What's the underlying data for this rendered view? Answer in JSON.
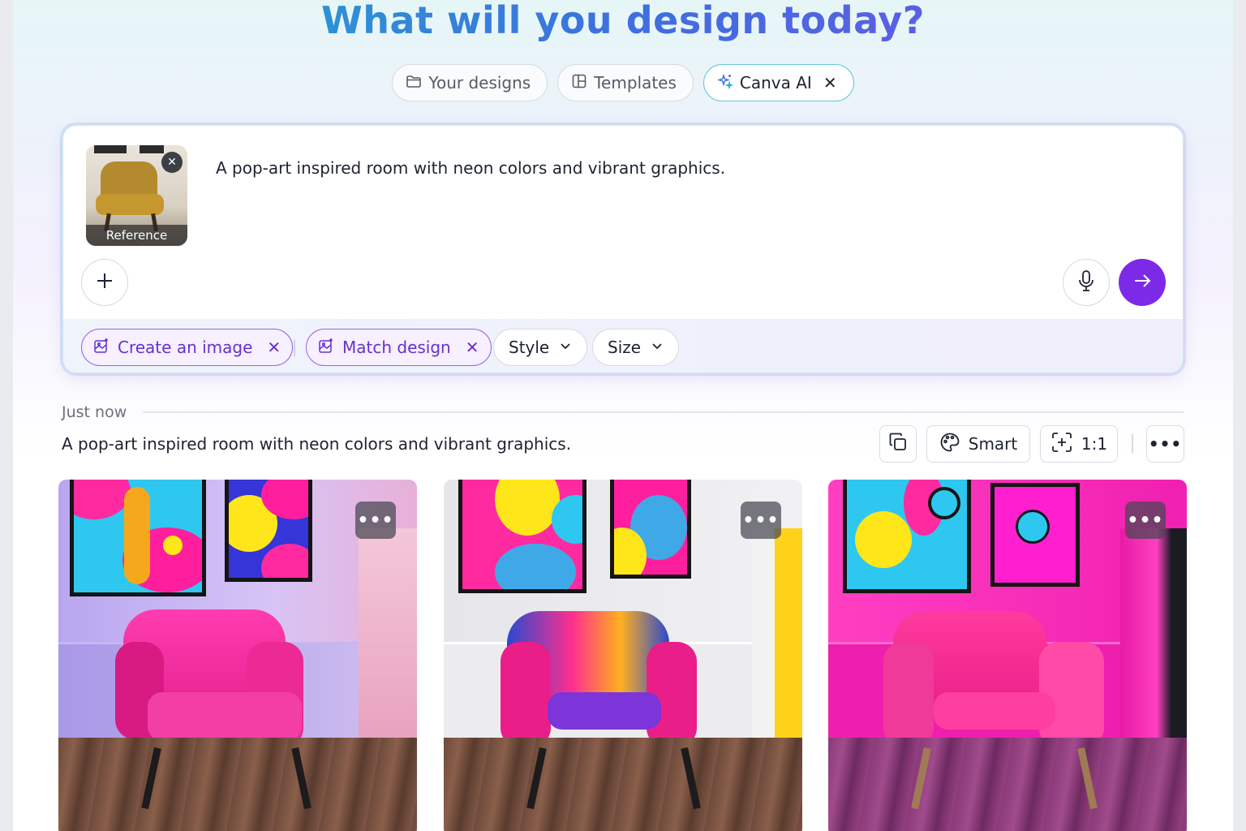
{
  "header": {
    "title": "What will you design today?"
  },
  "tabs": [
    {
      "label": "Your designs",
      "icon": "folder-icon"
    },
    {
      "label": "Templates",
      "icon": "template-icon"
    },
    {
      "label": "Canva AI",
      "icon": "sparkle-icon",
      "active": true
    }
  ],
  "prompt": {
    "text": "A pop-art inspired room with neon colors and vibrant graphics.",
    "reference_label": "Reference"
  },
  "chips": {
    "create_image": "Create an image",
    "match_design": "Match design",
    "style": "Style",
    "size": "Size"
  },
  "result": {
    "timestamp": "Just now",
    "prompt": "A pop-art inspired room with neon colors and vibrant graphics.",
    "mode_label": "Smart",
    "ratio_label": "1:1",
    "more_label": "•••"
  },
  "colors": {
    "accent_purple": "#7d2ae8",
    "chip_purple": "#6a2fd0",
    "teal_border": "#62c8d4"
  }
}
